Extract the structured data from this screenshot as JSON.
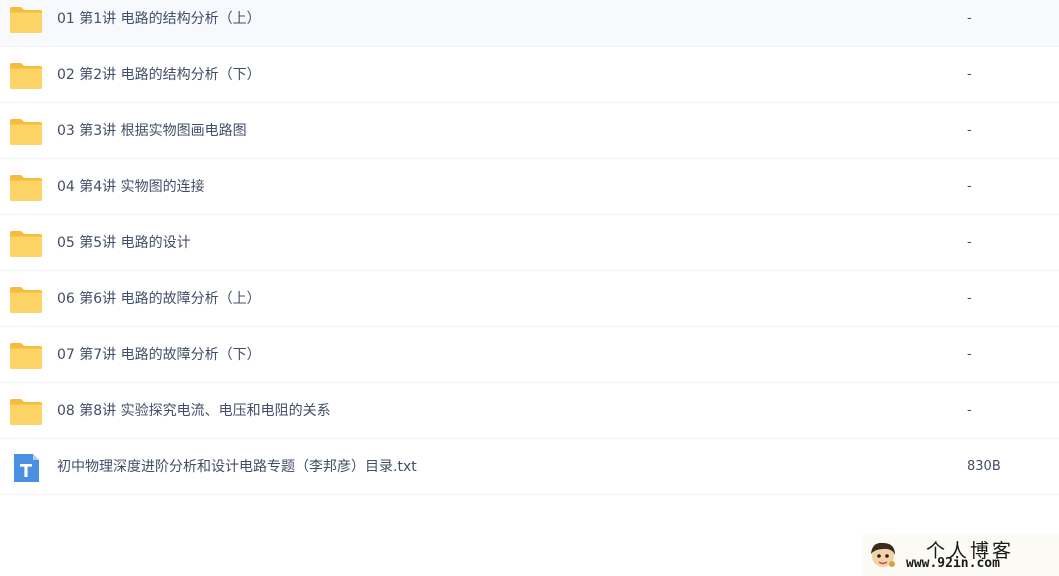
{
  "file_list": {
    "items": [
      {
        "name": "01 第1讲 电路的结构分析（上）",
        "size": "-",
        "type": "folder"
      },
      {
        "name": "02 第2讲 电路的结构分析（下）",
        "size": "-",
        "type": "folder"
      },
      {
        "name": "03 第3讲 根据实物图画电路图",
        "size": "-",
        "type": "folder"
      },
      {
        "name": "04 第4讲 实物图的连接",
        "size": "-",
        "type": "folder"
      },
      {
        "name": "05 第5讲 电路的设计",
        "size": "-",
        "type": "folder"
      },
      {
        "name": "06 第6讲 电路的故障分析（上）",
        "size": "-",
        "type": "folder"
      },
      {
        "name": "07 第7讲 电路的故障分析（下）",
        "size": "-",
        "type": "folder"
      },
      {
        "name": "08 第8讲 实验探究电流、电压和电阻的关系",
        "size": "-",
        "type": "folder"
      },
      {
        "name": "初中物理深度进阶分析和设计电路专题（李邦彦）目录.txt",
        "size": "830B",
        "type": "text-file"
      }
    ]
  },
  "icons": {
    "folder": "folder-icon",
    "text_file": "text-file-icon",
    "watermark_avatar": "cartoon-avatar-icon"
  },
  "colors": {
    "folder_back": "#f7c548",
    "folder_front": "#ffd466",
    "text_file": "#4a90e2",
    "text": "#424e67",
    "row_divider": "#f1f2f4"
  },
  "watermark": {
    "title": "个人博客",
    "url": "www.92in.com"
  }
}
